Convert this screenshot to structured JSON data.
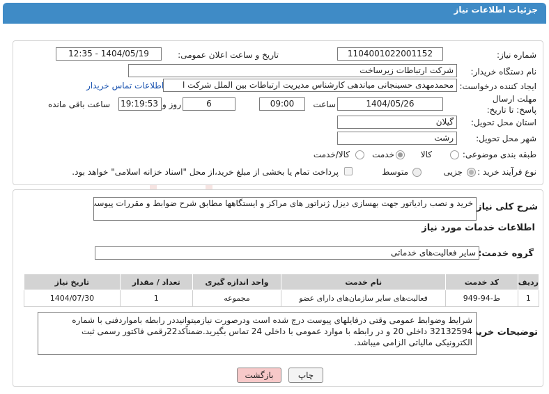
{
  "header": {
    "title": "جزئیات اطلاعات نیاز"
  },
  "info": {
    "need_number_label": "شماره نیاز:",
    "need_number": "1104001022001152",
    "announce_datetime_label": "تاریخ و ساعت اعلان عمومی:",
    "announce_datetime": "1404/05/19 - 12:35",
    "buyer_org_label": "نام دستگاه خریدار:",
    "buyer_org": "شرکت ارتباطات زیرساخت",
    "requester_label": "ایجاد کننده درخواست:",
    "requester": "محمدمهدی حسینجانی میاندهی کارشناس مدیریت ارتباطات بین الملل شرکت ا",
    "buyer_contact_link": "اطلاعات تماس خریدار",
    "deadline_label": "مهلت ارسال پاسخ: تا تاریخ:",
    "deadline_date": "1404/05/26",
    "time_label": "ساعت",
    "deadline_time": "09:00",
    "days_value": "6",
    "days_label": "روز و",
    "remaining_time": "19:19:53",
    "remaining_label": "ساعت باقی مانده",
    "province_label": "استان محل تحویل:",
    "province": "گیلان",
    "city_label": "شهر محل تحویل:",
    "city": "رشت",
    "category_label": "طبقه بندی موضوعی:",
    "category_options": [
      "کالا",
      "خدمت",
      "کالا/خدمت"
    ],
    "category_selected": "خدمت",
    "process_label": "نوع فرآیند خرید :",
    "process_options": [
      "جزیی",
      "متوسط"
    ],
    "process_selected": "جزیی",
    "payment_note": "پرداخت تمام یا بخشی از مبلغ خرید،از محل \"اسناد خزانه اسلامی\" خواهد بود."
  },
  "description": {
    "label": "شرح کلی نیاز:",
    "text": "خرید و نصب رادیاتور جهت بهسازی دیزل ژنراتور های مراکز و ایستگاهها مطابق شرح ضوابط و مقررات پیوست"
  },
  "services": {
    "section_title": "اطلاعات خدمات مورد نیاز",
    "group_label": "گروه خدمت:",
    "group_value": "سایر فعالیت‌های خدماتی",
    "columns": [
      "ردیف",
      "کد خدمت",
      "نام خدمت",
      "واحد اندازه گیری",
      "تعداد / مقدار",
      "تاریخ نیاز"
    ],
    "rows": [
      [
        "1",
        "ط-94-949",
        "فعالیت‌های سایر سازمان‌های دارای عضو",
        "مجموعه",
        "1",
        "1404/07/30"
      ]
    ]
  },
  "buyer_notes": {
    "label": "توضیحات خریدار:",
    "text": "شرایط وضوابط عمومی وقتی درفایلهای پیوست درج شده است ودرصورت نیازمیتوانیددر رابطه بامواردفنی با شماره 32132594 داخلی 20 و در رابطه با موارد عمومی با داخلی 24 تماس  بگیرید.ضمناًکد22رقمی فاکتور رسمی ثبت الکترونیکی مالیاتی الزامی میباشد."
  },
  "buttons": {
    "print": "چاپ",
    "back": "بازگشت"
  },
  "watermark": {
    "text": "AriaTender.neT"
  },
  "colors": {
    "header": "#3f8bc6",
    "back_button": "#f7c9c9",
    "watermark": "#c0392b"
  }
}
